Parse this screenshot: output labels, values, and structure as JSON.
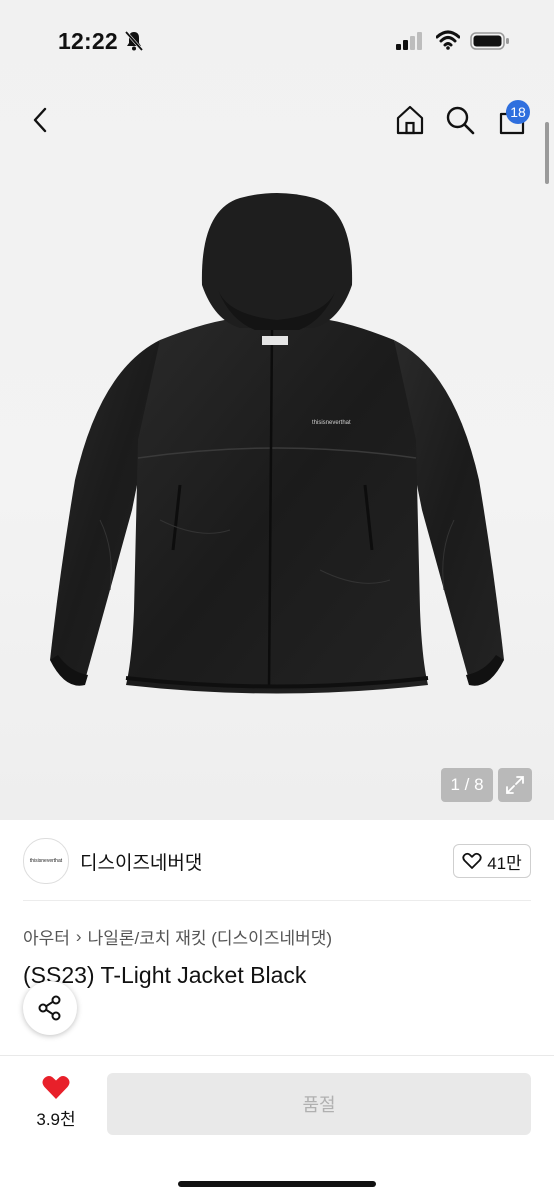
{
  "status_bar": {
    "time": "12:22"
  },
  "header": {
    "cart_count": "18"
  },
  "gallery": {
    "counter": "1 / 8"
  },
  "jacket_logo": "thisisneverthat",
  "brand": {
    "name": "디스이즈네버댓",
    "logo_text": "thisisneverthat",
    "likes": "41만"
  },
  "breadcrumb": {
    "parent": "아우터",
    "current": "나일론/코치 재킷 (디스이즈네버댓)"
  },
  "product": {
    "title": "(SS23) T-Light Jacket Black"
  },
  "bottom": {
    "wish_count": "3.9천",
    "buy_label": "품절"
  },
  "colors": {
    "heart": "#e8202a",
    "badge": "#2f6fde"
  },
  "icons": [
    "bell-slash-icon",
    "signal-icon",
    "wifi-icon",
    "battery-icon",
    "back-icon",
    "home-icon",
    "search-icon",
    "cart-icon",
    "expand-icon",
    "heart-outline-icon",
    "share-icon",
    "heart-filled-icon"
  ]
}
